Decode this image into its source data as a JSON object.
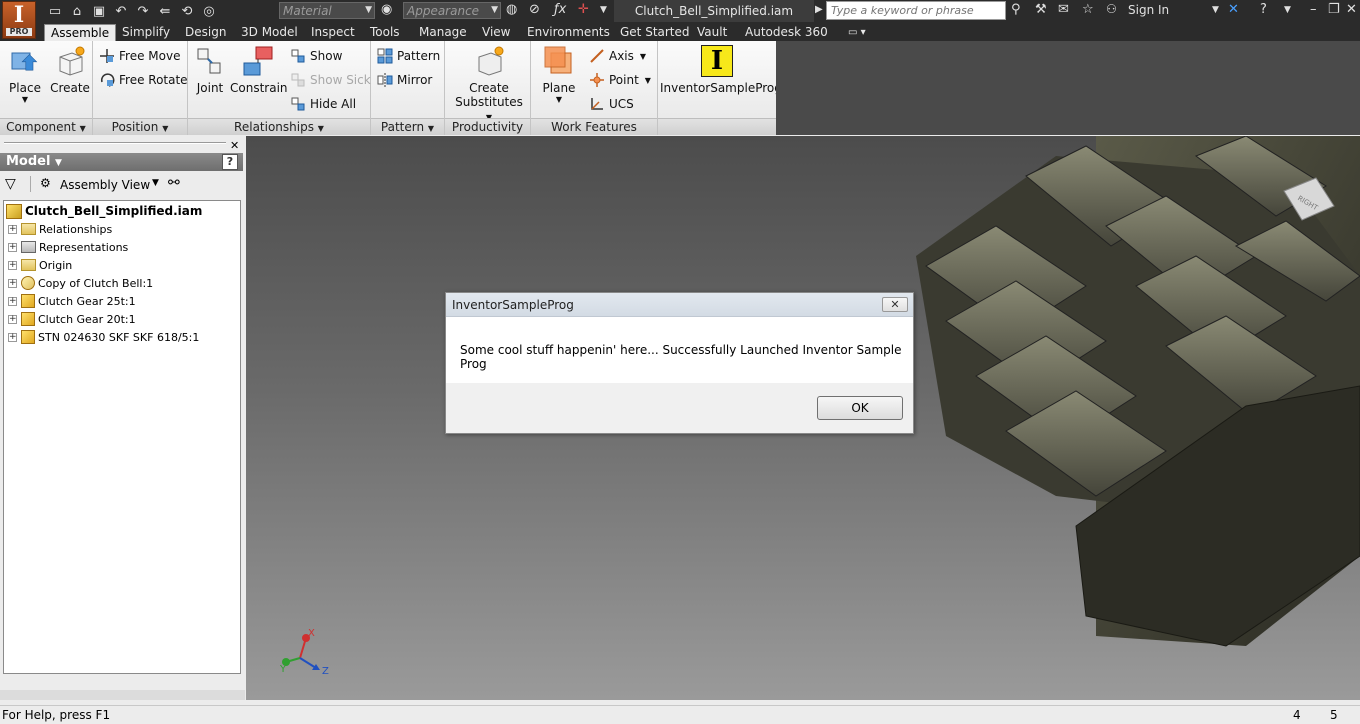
{
  "titlebar": {
    "logo_letter": "I",
    "logo_edition": "PRO",
    "material_placeholder": "Material",
    "appearance_placeholder": "Appearance",
    "document_title": "Clutch_Bell_Simplified.iam",
    "search_placeholder": "Type a keyword or phrase",
    "sign_in": "Sign In"
  },
  "tabs": [
    {
      "label": "Assemble",
      "active": true
    },
    {
      "label": "Simplify"
    },
    {
      "label": "Design"
    },
    {
      "label": "3D Model"
    },
    {
      "label": "Inspect"
    },
    {
      "label": "Tools"
    },
    {
      "label": "Manage"
    },
    {
      "label": "View"
    },
    {
      "label": "Environments"
    },
    {
      "label": "Get Started"
    },
    {
      "label": "Vault"
    },
    {
      "label": "Autodesk 360"
    }
  ],
  "ribbon": {
    "component": {
      "title": "Component",
      "place": "Place",
      "create": "Create"
    },
    "position": {
      "title": "Position",
      "free_move": "Free Move",
      "free_rotate": "Free Rotate"
    },
    "relationships": {
      "title": "Relationships",
      "joint": "Joint",
      "constrain": "Constrain",
      "show": "Show",
      "show_sick": "Show Sick",
      "hide_all": "Hide All"
    },
    "pattern": {
      "title": "Pattern",
      "pattern": "Pattern",
      "mirror": "Mirror"
    },
    "productivity": {
      "title": "Productivity",
      "create_substitutes_1": "Create",
      "create_substitutes_2": "Substitutes"
    },
    "work_features": {
      "title": "Work Features",
      "plane": "Plane",
      "axis": "Axis",
      "point": "Point",
      "ucs": "UCS"
    },
    "addin": {
      "label": "InventorSampleProg",
      "icon_letter": "I"
    }
  },
  "browser": {
    "header": "Model",
    "view_mode": "Assembly View",
    "root": "Clutch_Bell_Simplified.iam",
    "nodes": [
      {
        "label": "Relationships",
        "icon": "folder-icon"
      },
      {
        "label": "Representations",
        "icon": "representations-icon"
      },
      {
        "label": "Origin",
        "icon": "folder-icon"
      },
      {
        "label": "Copy of Clutch Bell:1",
        "icon": "substitute-part-icon"
      },
      {
        "label": "Clutch Gear 25t:1",
        "icon": "part-icon"
      },
      {
        "label": "Clutch Gear 20t:1",
        "icon": "part-icon"
      },
      {
        "label": "STN 024630 SKF SKF 618/5:1",
        "icon": "part-icon"
      }
    ]
  },
  "viewport": {
    "viewcube_label": "RIGHT",
    "axis_x": "X",
    "axis_y": "Y",
    "axis_z": "Z"
  },
  "dialog": {
    "title": "InventorSampleProg",
    "message": "Some cool stuff happenin' here... Successfully Launched Inventor Sample Prog",
    "ok_label": "OK"
  },
  "statusbar": {
    "help_text": "For Help, press F1",
    "count_1": "4",
    "count_2": "5"
  }
}
